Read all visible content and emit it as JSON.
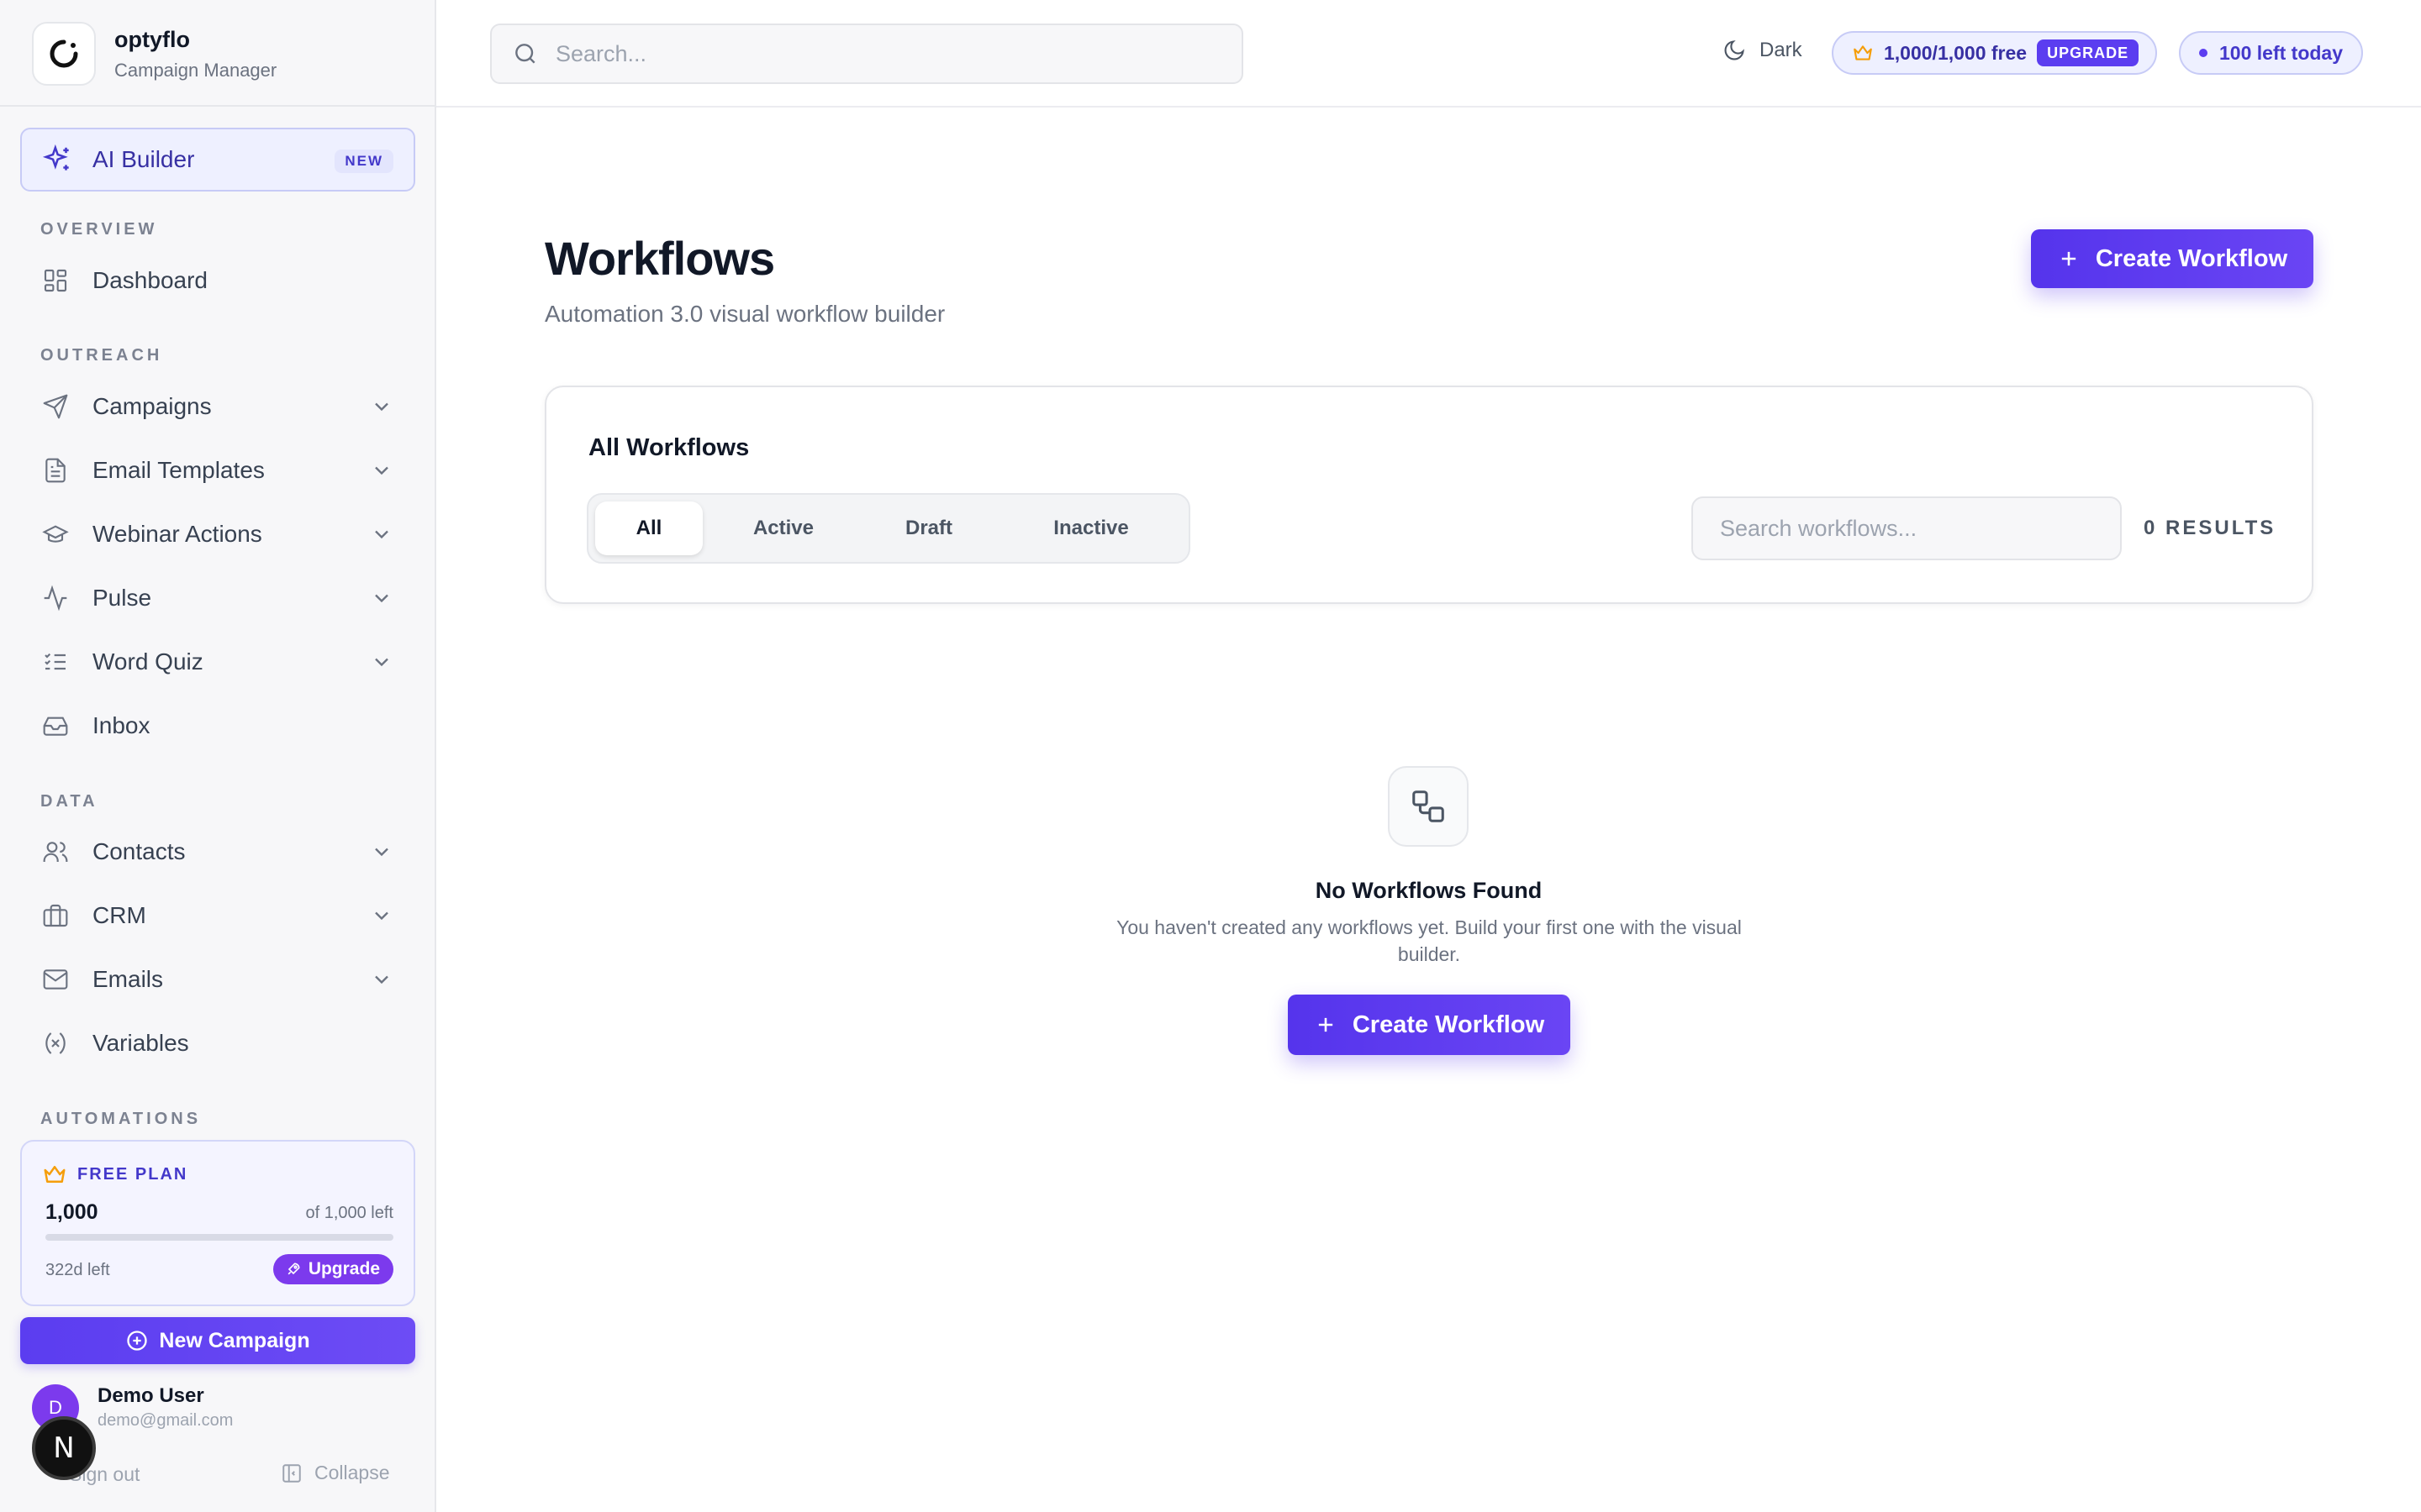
{
  "brand": {
    "name": "optyflo",
    "subtitle": "Campaign Manager"
  },
  "sidebar": {
    "ai_builder": {
      "label": "AI Builder",
      "badge": "NEW"
    },
    "sections": {
      "overview": "OVERVIEW",
      "outreach": "OUTREACH",
      "data": "DATA",
      "automations": "AUTOMATIONS"
    },
    "items": [
      {
        "label": "Dashboard",
        "icon": "dashboard-icon",
        "expandable": false
      },
      {
        "label": "Campaigns",
        "icon": "send-icon",
        "expandable": true
      },
      {
        "label": "Email Templates",
        "icon": "document-icon",
        "expandable": true
      },
      {
        "label": "Webinar Actions",
        "icon": "graduation-cap-icon",
        "expandable": true
      },
      {
        "label": "Pulse",
        "icon": "activity-icon",
        "expandable": true
      },
      {
        "label": "Word Quiz",
        "icon": "checklist-icon",
        "expandable": true
      },
      {
        "label": "Inbox",
        "icon": "inbox-icon",
        "expandable": false
      },
      {
        "label": "Contacts",
        "icon": "users-icon",
        "expandable": true
      },
      {
        "label": "CRM",
        "icon": "briefcase-icon",
        "expandable": true
      },
      {
        "label": "Emails",
        "icon": "mail-icon",
        "expandable": true
      },
      {
        "label": "Variables",
        "icon": "variable-icon",
        "expandable": false
      }
    ],
    "plan": {
      "title": "FREE PLAN",
      "count": "1,000",
      "of_text": "of 1,000 left",
      "days_left": "322d left",
      "upgrade_label": "Upgrade",
      "usage_fraction": 1.0
    },
    "new_campaign_label": "New Campaign",
    "user": {
      "initial": "D",
      "name": "Demo User",
      "email": "demo@gmail.com"
    },
    "sign_out_label": "Sign out",
    "collapse_label": "Collapse",
    "next_badge": "N"
  },
  "topbar": {
    "search_placeholder": "Search...",
    "theme_label": "Dark",
    "credits_text": "1,000/1,000 free",
    "upgrade_tag": "UPGRADE",
    "today_text": "100 left today"
  },
  "main": {
    "title": "Workflows",
    "subtitle": "Automation 3.0 visual workflow builder",
    "create_label": "Create Workflow",
    "filter": {
      "title": "All Workflows",
      "tabs": [
        "All",
        "Active",
        "Draft",
        "Inactive"
      ],
      "active_tab": "All",
      "search_placeholder": "Search workflows...",
      "results_text": "0 RESULTS"
    },
    "empty": {
      "title": "No Workflows Found",
      "description": "You haven't created any workflows yet. Build your first one with the visual builder.",
      "create_label": "Create Workflow"
    }
  },
  "colors": {
    "accent": "#5b3df0",
    "accent_light": "#eef0ff",
    "sidebar_bg": "#f7f7f9",
    "upgrade_purple": "#7c3aed"
  }
}
